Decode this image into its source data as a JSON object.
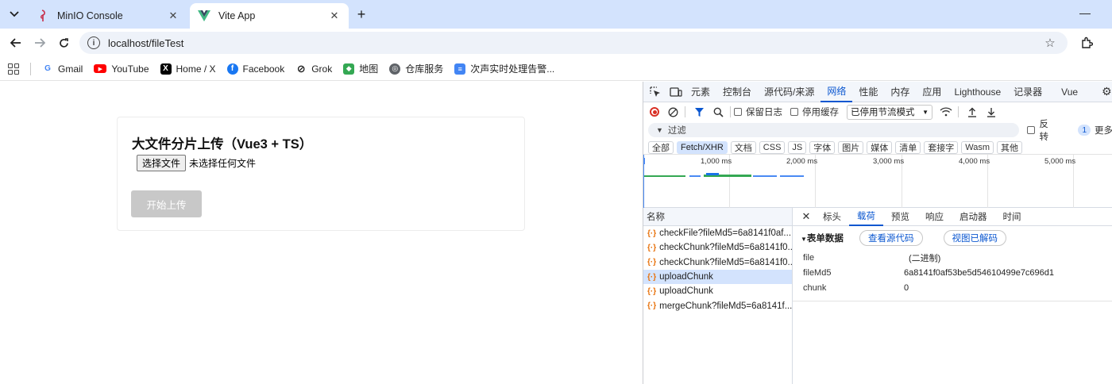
{
  "browser": {
    "tabs": [
      {
        "title": "MinIO Console",
        "active": false
      },
      {
        "title": "Vite App",
        "active": true
      }
    ],
    "url": "localhost/fileTest",
    "bookmarks": [
      {
        "label": "Gmail",
        "icon": "gmail-icon"
      },
      {
        "label": "YouTube",
        "icon": "youtube-icon"
      },
      {
        "label": "Home / X",
        "icon": "x-icon"
      },
      {
        "label": "Facebook",
        "icon": "facebook-icon"
      },
      {
        "label": "Grok",
        "icon": "grok-icon"
      },
      {
        "label": "地图",
        "icon": "maps-icon"
      },
      {
        "label": "仓库服务",
        "icon": "globe-icon"
      },
      {
        "label": "次声实时处理告警...",
        "icon": "docs-icon"
      }
    ]
  },
  "page": {
    "title": "大文件分片上传（Vue3 + TS）",
    "choose_file_label": "选择文件",
    "file_status": "未选择任何文件",
    "upload_label": "开始上传"
  },
  "devtools": {
    "tabs": [
      "元素",
      "控制台",
      "源代码/来源",
      "网络",
      "性能",
      "内存",
      "应用",
      "Lighthouse",
      "记录器",
      "Vue"
    ],
    "active_tab": "网络",
    "preserve_log": "保留日志",
    "disable_cache": "停用缓存",
    "throttle": "已停用节流模式",
    "filter_placeholder": "过滤",
    "invert": "反转",
    "more_filters_badge": "1",
    "more_filters": "更多",
    "type_filters": [
      "全部",
      "Fetch/XHR",
      "文档",
      "CSS",
      "JS",
      "字体",
      "图片",
      "媒体",
      "清单",
      "套接字",
      "Wasm",
      "其他"
    ],
    "active_type": "Fetch/XHR",
    "timeline_ticks": [
      "1,000 ms",
      "2,000 ms",
      "3,000 ms",
      "4,000 ms",
      "5,000 ms"
    ],
    "name_header": "名称",
    "requests": [
      {
        "name": "checkFile?fileMd5=6a8141f0af...",
        "selected": false
      },
      {
        "name": "checkChunk?fileMd5=6a8141f0...",
        "selected": false
      },
      {
        "name": "checkChunk?fileMd5=6a8141f0...",
        "selected": false
      },
      {
        "name": "uploadChunk",
        "selected": true
      },
      {
        "name": "uploadChunk",
        "selected": false
      },
      {
        "name": "mergeChunk?fileMd5=6a8141f...",
        "selected": false
      }
    ],
    "detail_tabs": [
      "标头",
      "载荷",
      "预览",
      "响应",
      "启动器",
      "时间"
    ],
    "active_detail_tab": "载荷",
    "form_data_title": "表单数据",
    "view_source": "查看源代码",
    "view_decoded": "视图已解码",
    "payload": [
      {
        "key": "file",
        "value": "(二进制)"
      },
      {
        "key": "fileMd5",
        "value": "6a8141f0af53be5d54610499e7c696d1"
      },
      {
        "key": "chunk",
        "value": "0"
      }
    ]
  },
  "colors": {
    "accent": "#0b57d0",
    "tabstrip": "#d3e3fd",
    "record_red": "#d93025",
    "disabled_button": "#c8c8c8"
  }
}
